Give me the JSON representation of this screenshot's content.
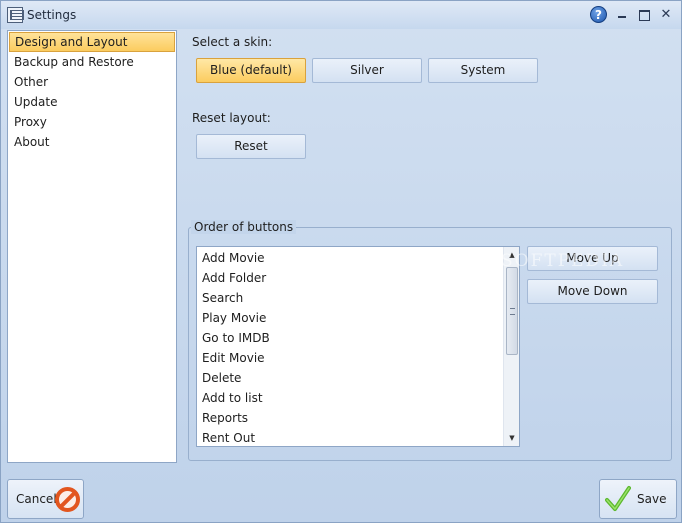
{
  "window": {
    "title": "Settings"
  },
  "titlebar": {
    "help_glyph": "?",
    "close_glyph": "✕"
  },
  "sidebar": {
    "items": [
      {
        "label": "Design and Layout",
        "active": true
      },
      {
        "label": "Backup and Restore",
        "active": false
      },
      {
        "label": "Other",
        "active": false
      },
      {
        "label": "Update",
        "active": false
      },
      {
        "label": "Proxy",
        "active": false
      },
      {
        "label": "About",
        "active": false
      }
    ]
  },
  "skin": {
    "label": "Select a skin:",
    "options": [
      "Blue (default)",
      "Silver",
      "System"
    ],
    "selected": "Blue (default)"
  },
  "reset": {
    "label": "Reset layout:",
    "button": "Reset"
  },
  "order": {
    "title": "Order of buttons",
    "items": [
      "Add Movie",
      "Add Folder",
      "Search",
      "Play Movie",
      "Go to IMDB",
      "Edit Movie",
      "Delete",
      "Add to list",
      "Reports",
      "Rent Out"
    ],
    "move_up": "Move Up",
    "move_down": "Move Down",
    "scroll_up_glyph": "▲",
    "scroll_down_glyph": "▼"
  },
  "watermark": "SOFTPEDIA",
  "footer": {
    "cancel": "Cancel",
    "save": "Save"
  },
  "colors": {
    "accent_selected": "#fbcc5f",
    "window_bg": "#c4d6ec",
    "cancel_icon": "#e2561f",
    "save_icon": "#5cb82e"
  }
}
